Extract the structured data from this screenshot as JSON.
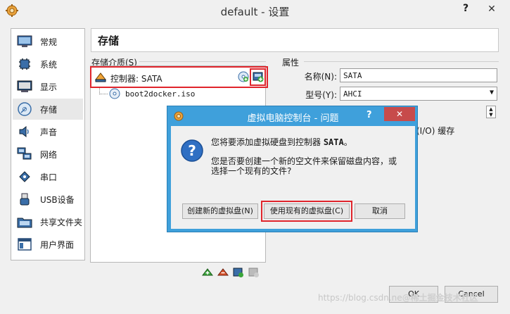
{
  "window": {
    "title": "default - 设置",
    "help_label": "?",
    "close_label": "✕"
  },
  "sidebar": {
    "items": [
      {
        "label": "常规",
        "icon": "general-icon"
      },
      {
        "label": "系统",
        "icon": "system-chip-icon"
      },
      {
        "label": "显示",
        "icon": "display-monitor-icon"
      },
      {
        "label": "存储",
        "icon": "storage-disk-icon",
        "selected": true
      },
      {
        "label": "声音",
        "icon": "speaker-icon"
      },
      {
        "label": "网络",
        "icon": "network-icon"
      },
      {
        "label": "串口",
        "icon": "serial-port-icon"
      },
      {
        "label": "USB设备",
        "icon": "usb-icon"
      },
      {
        "label": "共享文件夹",
        "icon": "shared-folder-icon"
      },
      {
        "label": "用户界面",
        "icon": "user-interface-icon"
      }
    ]
  },
  "section": {
    "title": "存储"
  },
  "storage": {
    "group_label": "存储介质(S)",
    "controller_label": "控制器: SATA",
    "disk_label": "boot2docker.iso"
  },
  "attributes": {
    "group_label": "属性",
    "name_label": "名称(N):",
    "name_value": "SATA",
    "type_label": "型号(Y):",
    "type_value": "AHCI",
    "io_cache_label": "(I/O) 缓存"
  },
  "dialog": {
    "title": "虚拟电脑控制台 - 问题",
    "help_label": "?",
    "close_label": "✕",
    "line1_prefix": "您将要添加虚拟硬盘到控制器 ",
    "line1_controller": "SATA",
    "line1_suffix": "。",
    "line2": "您是否要创建一个新的空文件来保留磁盘内容，或",
    "line3": "选择一个现有的文件?",
    "create_button": "创建新的虚拟盘(N)",
    "use_existing_button": "使用现有的虚拟盘(C)",
    "cancel_button": "取消"
  },
  "buttons": {
    "ok": "OK",
    "cancel": "Cancel"
  },
  "watermark": {
    "left": "https://blog.csdn.ne",
    "right": "@稀土掘金技术社区"
  },
  "colors": {
    "highlight": "#e0252c",
    "dialog_frame": "#3fa0db",
    "dialog_close": "#c74b4b"
  }
}
